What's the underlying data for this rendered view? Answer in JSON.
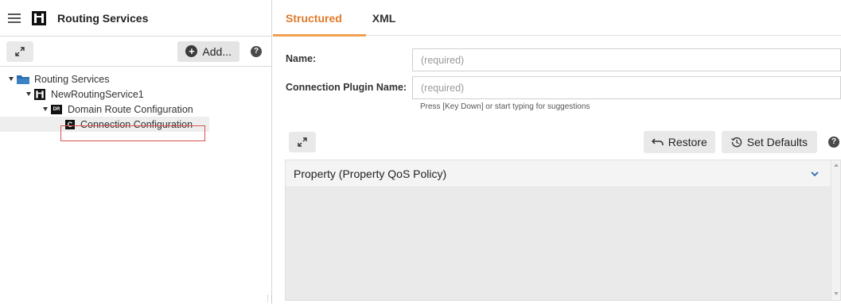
{
  "app": {
    "title": "Routing Services"
  },
  "left_toolbar": {
    "add_label": "Add...",
    "help_label": "?"
  },
  "tree": {
    "root": "Routing Services",
    "service": "NewRoutingService1",
    "domain_route": "Domain Route Configuration",
    "domain_route_badge": "DR",
    "connection": "Connection Configuration",
    "connection_badge": "C"
  },
  "tabs": [
    {
      "label": "Structured",
      "active": true
    },
    {
      "label": "XML",
      "active": false
    }
  ],
  "form": {
    "name_label": "Name:",
    "name_placeholder": "(required)",
    "plugin_label": "Connection Plugin Name:",
    "plugin_placeholder": "(required)",
    "hint": "Press [Key Down] or start typing for suggestions"
  },
  "property_toolbar": {
    "restore_label": "Restore",
    "defaults_label": "Set Defaults",
    "help_label": "?"
  },
  "property_section": {
    "title": "Property (Property QoS Policy)"
  },
  "colors": {
    "accent": "#e07a2a",
    "selection_outline": "#d9534f"
  },
  "icons": [
    "menu-icon",
    "routing-logo-icon",
    "expand-icon",
    "plus-circle-icon",
    "help-icon",
    "folder-icon",
    "undo-icon",
    "history-icon",
    "chevron-down-icon"
  ]
}
